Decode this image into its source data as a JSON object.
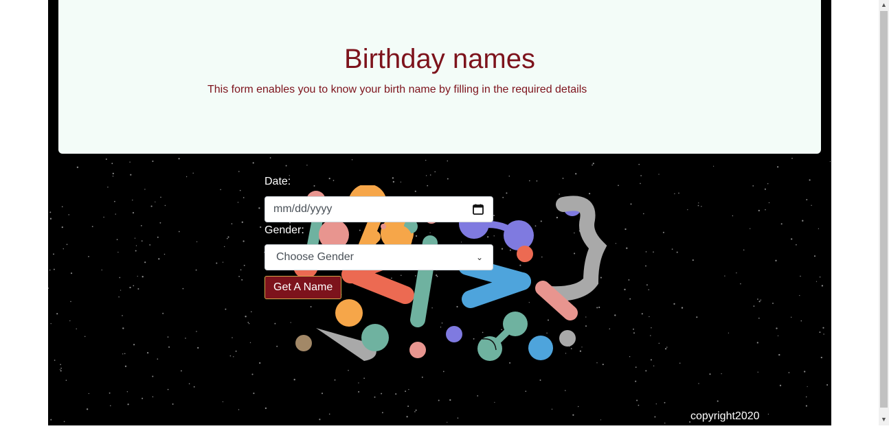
{
  "header": {
    "title": "Birthday names",
    "subtitle": "This form enables you to know your birth name by filling in the required details"
  },
  "form": {
    "date_label": "Date:",
    "date_placeholder": "mm/dd/yyyy",
    "gender_label": "Gender:",
    "gender_selected": "Choose Gender",
    "submit_label": "Get A Name"
  },
  "footer": {
    "copyright": "copyright2020"
  },
  "colors": {
    "brand": "#7d131c",
    "hero_bg": "#f3fcf8",
    "page_bg": "#000000"
  }
}
